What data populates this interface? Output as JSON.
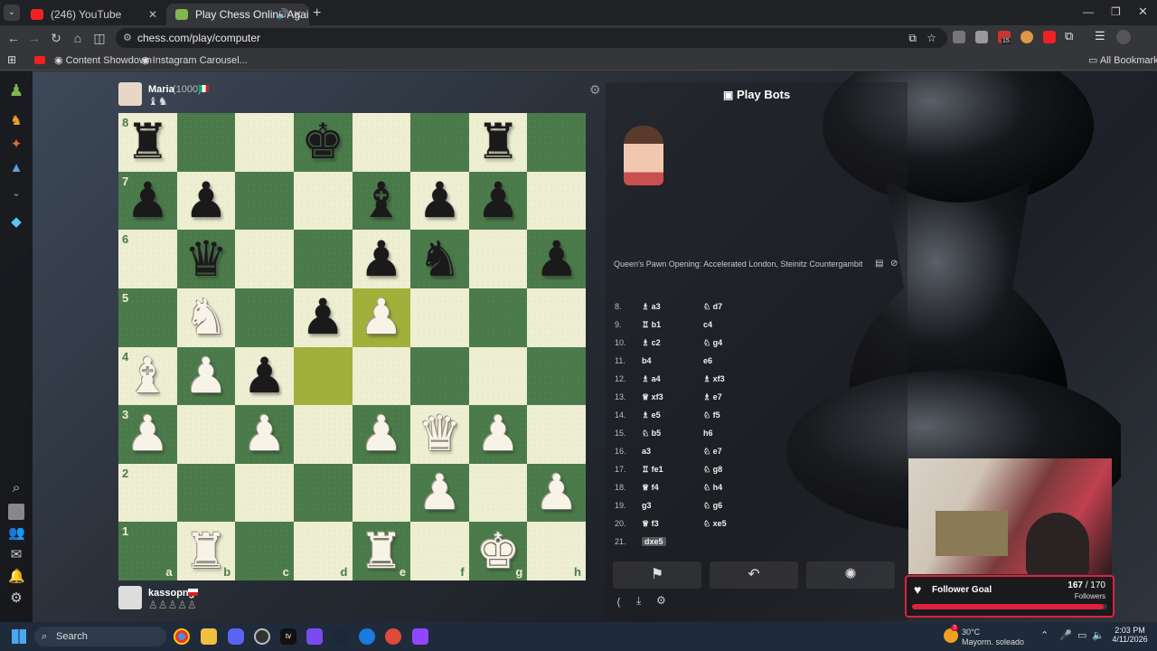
{
  "browser": {
    "tabs": [
      {
        "title": "(246) YouTube",
        "active": false
      },
      {
        "title": "Play Chess Online Against t",
        "active": true
      }
    ],
    "url": "chess.com/play/computer",
    "bookmarks": [
      "Content Showdown",
      "Instagram Carousel...",
      "All Bookmarks"
    ],
    "extension_badge": "15"
  },
  "top_player": {
    "name": "Maria",
    "rating": "(1000)"
  },
  "bottom_player": {
    "name": "kassopng"
  },
  "board": {
    "ranks": [
      "8",
      "7",
      "6",
      "5",
      "4",
      "3",
      "2",
      "1"
    ],
    "files": [
      "a",
      "b",
      "c",
      "d",
      "e",
      "f",
      "g",
      "h"
    ],
    "position": [
      [
        "bR",
        "",
        "",
        "bK",
        "",
        "",
        "bR",
        ""
      ],
      [
        "bP",
        "bP",
        "",
        "",
        "bB",
        "bP",
        "bP",
        ""
      ],
      [
        "",
        "bQ",
        "",
        "",
        "bP",
        "bN",
        "",
        "bP"
      ],
      [
        "",
        "wN",
        "",
        "bP",
        "wP",
        "",
        "",
        ""
      ],
      [
        "wB",
        "wP",
        "bP",
        "",
        "",
        "",
        "",
        ""
      ],
      [
        "wP",
        "",
        "wP",
        "",
        "wP",
        "wQ",
        "wP",
        ""
      ],
      [
        "",
        "",
        "",
        "",
        "",
        "wP",
        "",
        "wP"
      ],
      [
        "",
        "wR",
        "",
        "",
        "wR",
        "",
        "wK",
        ""
      ]
    ],
    "highlights": [
      "e5",
      "d4"
    ]
  },
  "panel": {
    "title": "Play Bots",
    "opening": "Queen's Pawn Opening: Accelerated London, Steinitz Countergambit",
    "moves": [
      {
        "n": "8.",
        "w": "a3",
        "wp": "bishop",
        "b": "d7",
        "bp": "knight"
      },
      {
        "n": "9.",
        "w": "b1",
        "wp": "rook",
        "b": "c4",
        "bp": ""
      },
      {
        "n": "10.",
        "w": "c2",
        "wp": "bishop",
        "b": "g4",
        "bp": "knight"
      },
      {
        "n": "11.",
        "w": "b4",
        "wp": "",
        "b": "e6",
        "bp": ""
      },
      {
        "n": "12.",
        "w": "a4",
        "wp": "bishop",
        "b": "xf3",
        "bp": "bishop"
      },
      {
        "n": "13.",
        "w": "xf3",
        "wp": "queen",
        "b": "e7",
        "bp": "bishop"
      },
      {
        "n": "14.",
        "w": "e5",
        "wp": "bishop",
        "b": "f5",
        "bp": "knight"
      },
      {
        "n": "15.",
        "w": "b5",
        "wp": "knight",
        "b": "h6",
        "bp": ""
      },
      {
        "n": "16.",
        "w": "a3",
        "wp": "",
        "b": "e7",
        "bp": "knight"
      },
      {
        "n": "17.",
        "w": "fe1",
        "wp": "rook",
        "b": "g8",
        "bp": "knight"
      },
      {
        "n": "18.",
        "w": "f4",
        "wp": "queen",
        "b": "h4",
        "bp": "knight"
      },
      {
        "n": "19.",
        "w": "g3",
        "wp": "",
        "b": "g6",
        "bp": "knight"
      },
      {
        "n": "20.",
        "w": "f3",
        "wp": "queen",
        "b": "xe5",
        "bp": "knight"
      },
      {
        "n": "21.",
        "w": "dxe5",
        "wp": "",
        "b": "",
        "bp": ""
      }
    ]
  },
  "follower_goal": {
    "label": "Follower Goal",
    "current": "167",
    "target": "/ 170",
    "unit": "Followers",
    "progress": 0.982
  },
  "taskbar": {
    "search": "Search",
    "weather_temp": "30°C",
    "weather_desc": "Mayorm. soleado",
    "time": "2:03 PM",
    "date": "4/11/2026",
    "notif_badge": "3"
  }
}
